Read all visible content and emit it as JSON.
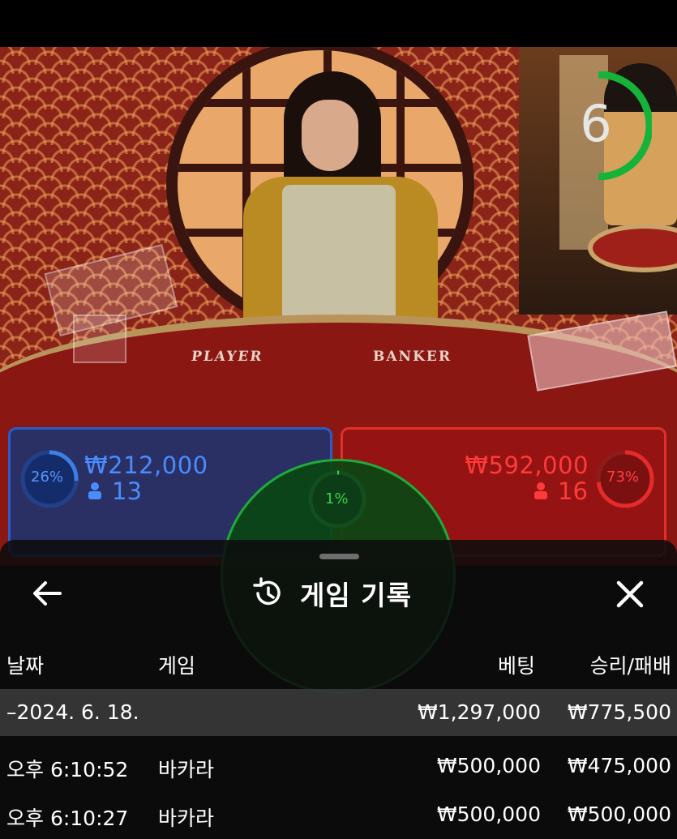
{
  "timer": {
    "seconds": "6",
    "color": "#16b33b"
  },
  "table_labels": {
    "player": "PLAYER",
    "banker": "BANKER"
  },
  "bets": {
    "player": {
      "percent": "26%",
      "percent_value": 0.26,
      "amount": "₩212,000",
      "players": "13",
      "color": "#3b7fe6"
    },
    "banker": {
      "percent": "73%",
      "percent_value": 0.73,
      "amount": "₩592,000",
      "players": "16",
      "color": "#e62b2b"
    },
    "tie": {
      "percent": "1%",
      "percent_value": 0.01,
      "color": "#35d14e"
    }
  },
  "sheet": {
    "title": "게임 기록",
    "icons": {
      "back": "arrow-left-icon",
      "history": "history-icon",
      "close": "close-icon"
    },
    "columns": {
      "date": "날짜",
      "game": "게임",
      "bet": "베팅",
      "result": "승리/패배"
    },
    "summary": {
      "date": "–2024. 6. 18.",
      "bet": "₩1,297,000",
      "result": "₩775,500"
    },
    "rows": [
      {
        "time": "오후 6:10:52",
        "game": "바카라",
        "bet": "₩500,000",
        "result": "₩475,000"
      },
      {
        "time": "오후 6:10:27",
        "game": "바카라",
        "bet": "₩500,000",
        "result": "₩500,000"
      }
    ]
  }
}
